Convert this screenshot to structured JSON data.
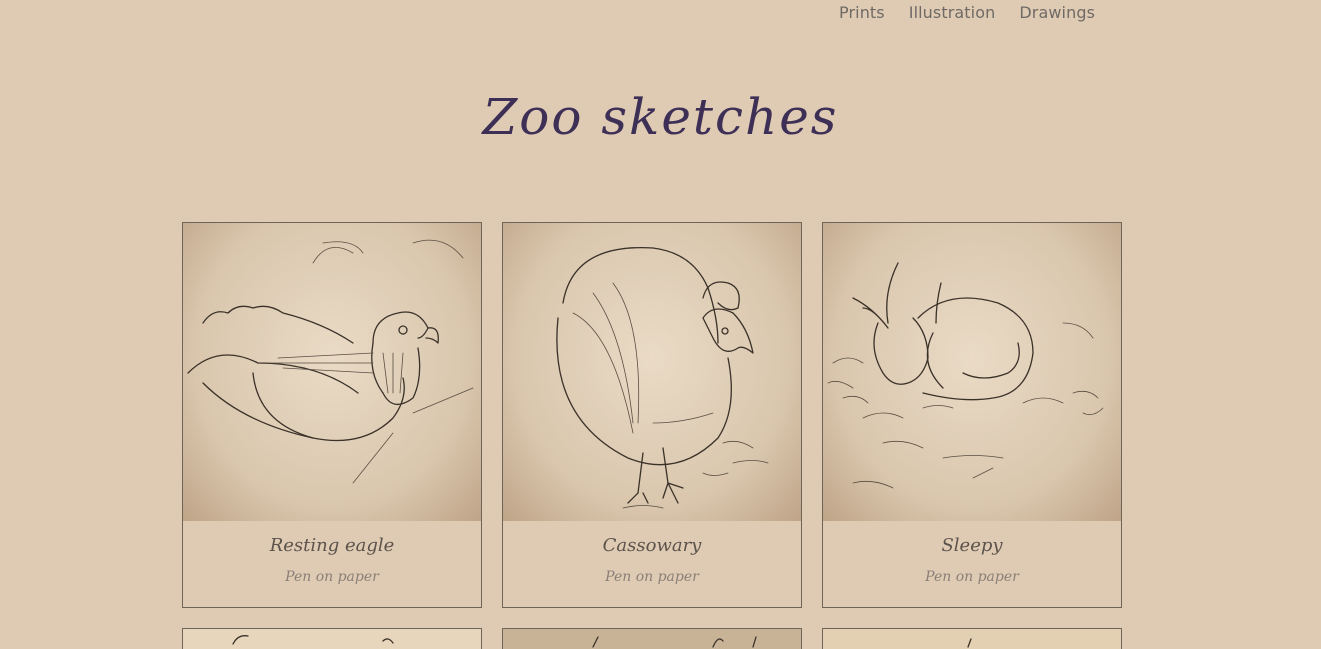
{
  "nav": {
    "items": [
      {
        "label": "Prints"
      },
      {
        "label": "Illustration"
      },
      {
        "label": "Drawings"
      }
    ]
  },
  "page": {
    "title": "Zoo sketches"
  },
  "gallery": {
    "cards": [
      {
        "title": "Resting eagle",
        "medium": "Pen on paper"
      },
      {
        "title": "Cassowary",
        "medium": "Pen on paper"
      },
      {
        "title": "Sleepy",
        "medium": "Pen on paper"
      }
    ]
  }
}
